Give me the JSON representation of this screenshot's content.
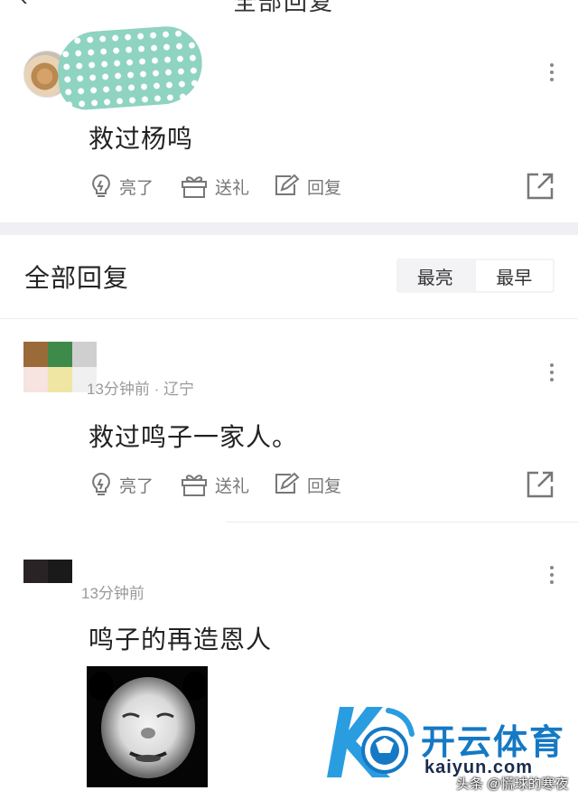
{
  "header": {
    "back_glyph": "‹",
    "title": "全部回复"
  },
  "colors": {
    "accent": "#1579c4",
    "divider": "#f0f0f4",
    "secondary_text": "#777777"
  },
  "main_comment": {
    "text": "救过杨鸣",
    "actions": {
      "like": "亮了",
      "gift": "送礼",
      "reply": "回复"
    }
  },
  "replies_section": {
    "title": "全部回复",
    "sort_options": [
      "最亮",
      "最早"
    ],
    "active_sort": "最早"
  },
  "replies": [
    {
      "meta": "13分钟前 · 辽宁",
      "text": "救过鸣子一家人。",
      "actions": {
        "like": "亮了",
        "gift": "送礼",
        "reply": "回复"
      }
    },
    {
      "meta": "13分钟前",
      "text": "鸣子的再造恩人",
      "has_sticker": true
    }
  ],
  "watermark": {
    "brand": "开云体育",
    "domain": "kaiyun.com",
    "credit": "头条 @慌球的寒夜"
  },
  "icons": [
    "more-icon",
    "like-icon",
    "gift-icon",
    "reply-icon",
    "share-icon",
    "back-icon"
  ]
}
